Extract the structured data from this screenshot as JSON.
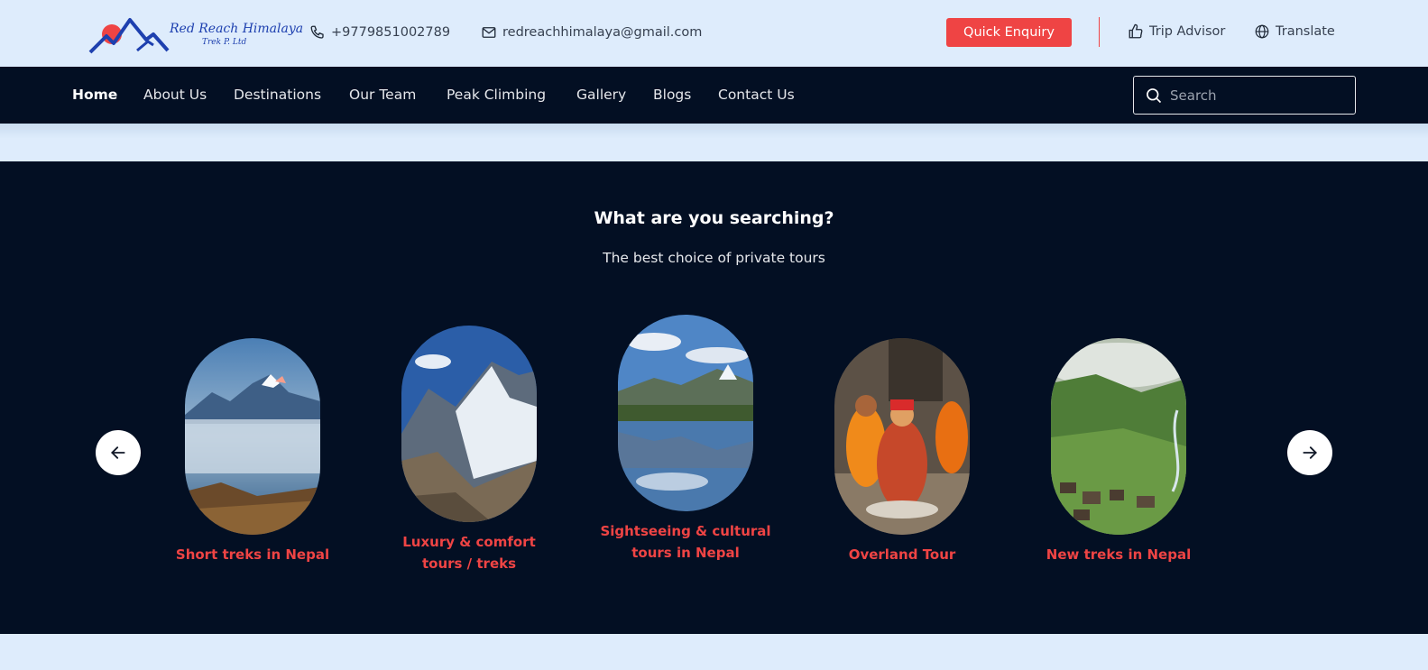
{
  "header": {
    "logo_alt": "Red Reach Himalaya",
    "logo_sub": "Trek P. Ltd",
    "phone": "+9779851002789",
    "email": "redreachhimalaya@gmail.com",
    "enquiry_label": "Quick Enquiry",
    "trip_advisor_label": "Trip Advisor",
    "translate_label": "Translate"
  },
  "nav": {
    "items": [
      {
        "label": "Home",
        "active": true
      },
      {
        "label": "About Us"
      },
      {
        "label": "Destinations"
      },
      {
        "label": "Our Team"
      },
      {
        "label": "Peak Climbing"
      },
      {
        "label": "Gallery"
      },
      {
        "label": "Blogs"
      },
      {
        "label": "Contact Us"
      }
    ],
    "search_placeholder": "Search"
  },
  "section": {
    "title": "What are you searching?",
    "subtitle": "The best choice of private tours",
    "cards": [
      {
        "label": "Short treks in Nepal",
        "image": "snowy-peak-above-clouds"
      },
      {
        "label": "Luxury & comfort tours / treks",
        "image": "snowy-mountain-ridge"
      },
      {
        "label": "Sightseeing & cultural tours in Nepal",
        "image": "lake-mountain-reflection"
      },
      {
        "label": "Overland Tour",
        "image": "sadhus-at-temple"
      },
      {
        "label": "New treks in Nepal",
        "image": "green-valley-village"
      }
    ]
  },
  "colors": {
    "accent": "#ef4444",
    "navy": "#030f23",
    "light_bg": "#deecfc"
  }
}
